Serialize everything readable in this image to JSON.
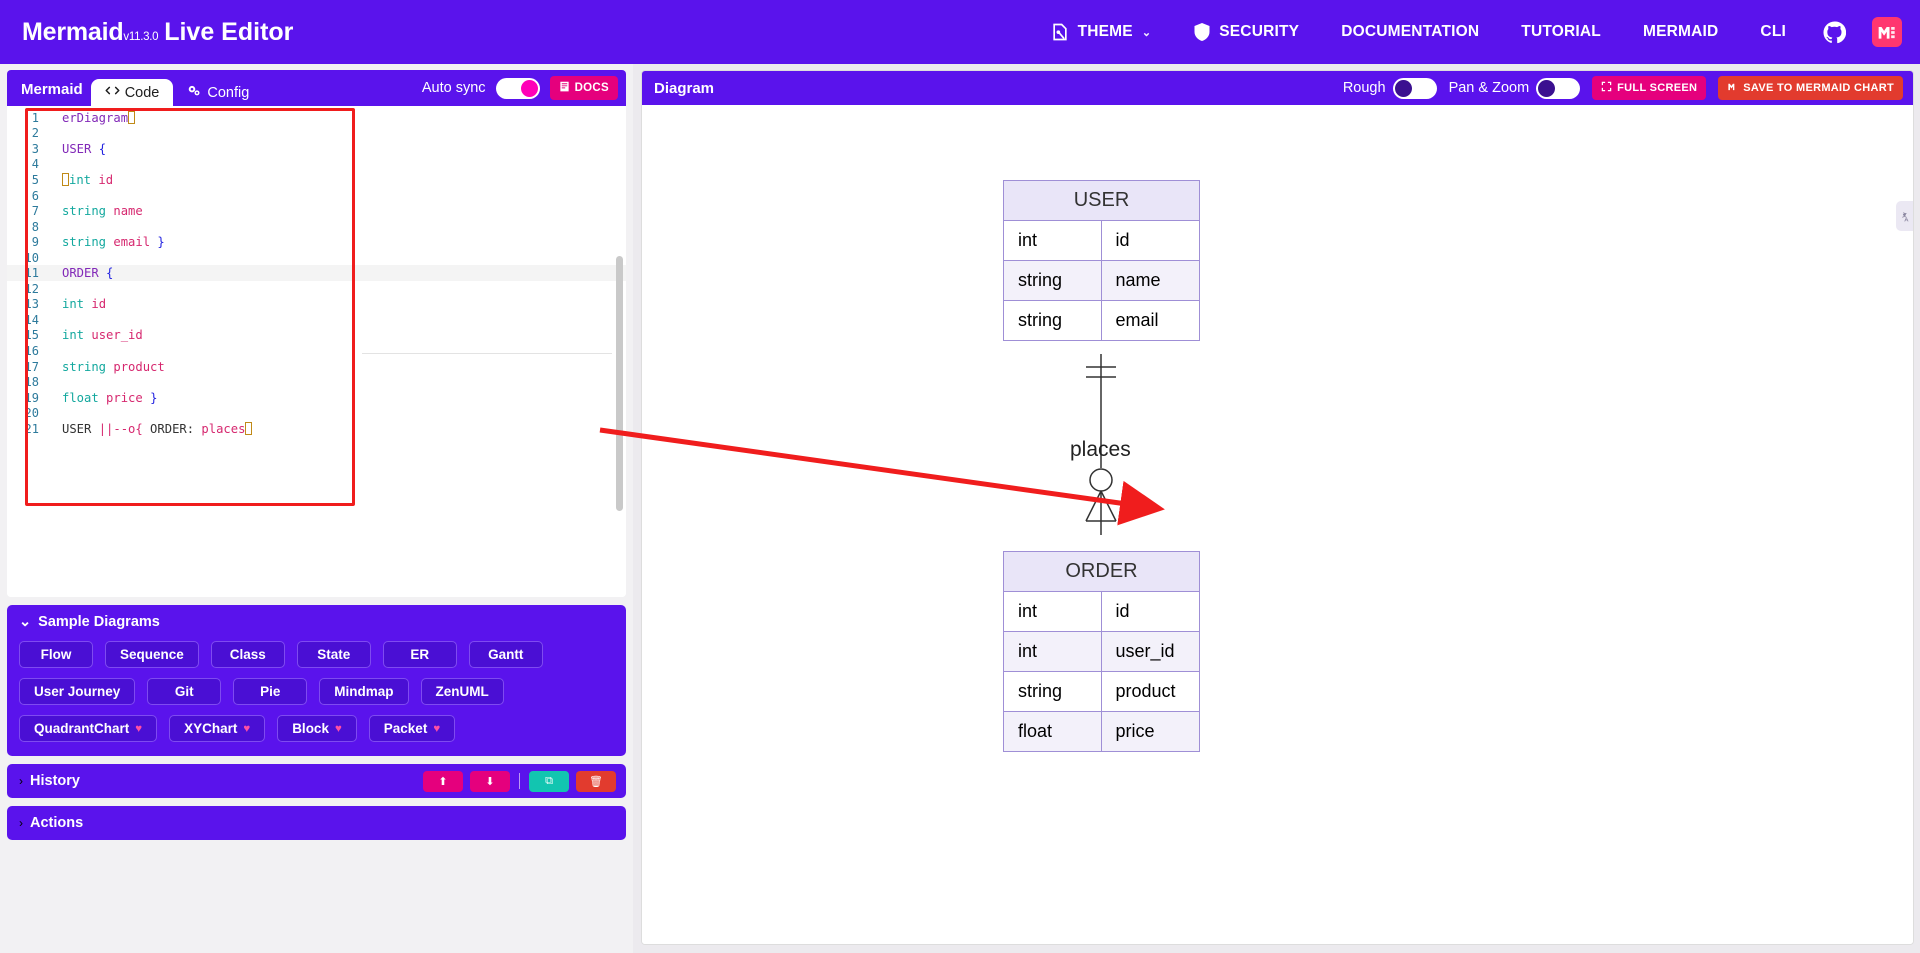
{
  "header": {
    "brand_main": "Mermaid",
    "brand_version": "v11.3.0",
    "brand_tail": "Live Editor",
    "nav": [
      {
        "label": "THEME",
        "icon": "theme-icon",
        "caret": "⌄"
      },
      {
        "label": "SECURITY",
        "icon": "shield-icon"
      },
      {
        "label": "DOCUMENTATION",
        "icon": ""
      },
      {
        "label": "TUTORIAL",
        "icon": ""
      },
      {
        "label": "MERMAID",
        "icon": ""
      },
      {
        "label": "CLI",
        "icon": ""
      }
    ],
    "github_icon": "github-icon",
    "mermaidchart_logo": "mermaid-chart-logo"
  },
  "editor": {
    "panel_label": "Mermaid",
    "tabs": [
      {
        "label": "Code",
        "icon": "code-icon",
        "active": true
      },
      {
        "label": "Config",
        "icon": "gear-icon",
        "active": false
      }
    ],
    "auto_sync_label": "Auto sync",
    "auto_sync_on": true,
    "docs_label": "DOCS",
    "docs_icon": "book-icon",
    "code_lines": [
      {
        "n": 1,
        "tokens": [
          {
            "t": "erDiagram",
            "c": "k-kw"
          },
          {
            "t": "▯",
            "c": "caret"
          }
        ]
      },
      {
        "n": 2,
        "tokens": []
      },
      {
        "n": 3,
        "tokens": [
          {
            "t": "USER ",
            "c": "k-kw"
          },
          {
            "t": "{",
            "c": "k-brace"
          }
        ]
      },
      {
        "n": 4,
        "tokens": []
      },
      {
        "n": 5,
        "tokens": [
          {
            "t": "▯",
            "c": "caret"
          },
          {
            "t": "int ",
            "c": "k-type"
          },
          {
            "t": "id",
            "c": "k-attr"
          }
        ]
      },
      {
        "n": 6,
        "tokens": []
      },
      {
        "n": 7,
        "tokens": [
          {
            "t": "string ",
            "c": "k-type"
          },
          {
            "t": "name",
            "c": "k-attr"
          }
        ]
      },
      {
        "n": 8,
        "tokens": []
      },
      {
        "n": 9,
        "tokens": [
          {
            "t": "string ",
            "c": "k-type"
          },
          {
            "t": "email ",
            "c": "k-attr"
          },
          {
            "t": "}",
            "c": "k-brace"
          }
        ]
      },
      {
        "n": 10,
        "tokens": []
      },
      {
        "n": 11,
        "tokens": [
          {
            "t": "ORDER ",
            "c": "k-kw"
          },
          {
            "t": "{",
            "c": "k-brace"
          }
        ],
        "highlight": true
      },
      {
        "n": 12,
        "tokens": []
      },
      {
        "n": 13,
        "tokens": [
          {
            "t": "int ",
            "c": "k-type"
          },
          {
            "t": "id",
            "c": "k-attr"
          }
        ]
      },
      {
        "n": 14,
        "tokens": []
      },
      {
        "n": 15,
        "tokens": [
          {
            "t": "int ",
            "c": "k-type"
          },
          {
            "t": "user_id",
            "c": "k-attr"
          }
        ]
      },
      {
        "n": 16,
        "tokens": []
      },
      {
        "n": 17,
        "tokens": [
          {
            "t": "string ",
            "c": "k-type"
          },
          {
            "t": "product",
            "c": "k-attr"
          }
        ]
      },
      {
        "n": 18,
        "tokens": []
      },
      {
        "n": 19,
        "tokens": [
          {
            "t": "float ",
            "c": "k-type"
          },
          {
            "t": "price ",
            "c": "k-attr"
          },
          {
            "t": "}",
            "c": "k-brace"
          }
        ]
      },
      {
        "n": 20,
        "tokens": []
      },
      {
        "n": 21,
        "tokens": [
          {
            "t": "USER ",
            "c": "k-plain"
          },
          {
            "t": "||--o{",
            "c": "k-rel"
          },
          {
            "t": " ORDER: ",
            "c": "k-plain"
          },
          {
            "t": "places",
            "c": "k-attr"
          },
          {
            "t": "▯",
            "c": "caret"
          }
        ]
      }
    ]
  },
  "samples": {
    "title": "Sample Diagrams",
    "chevron": "⌄",
    "buttons": [
      {
        "label": "Flow",
        "premium": false
      },
      {
        "label": "Sequence",
        "premium": false
      },
      {
        "label": "Class",
        "premium": false
      },
      {
        "label": "State",
        "premium": false
      },
      {
        "label": "ER",
        "premium": false
      },
      {
        "label": "Gantt",
        "premium": false
      },
      {
        "label": "User Journey",
        "premium": false
      },
      {
        "label": "Git",
        "premium": false
      },
      {
        "label": "Pie",
        "premium": false
      },
      {
        "label": "Mindmap",
        "premium": false
      },
      {
        "label": "ZenUML",
        "premium": false
      },
      {
        "label": "QuadrantChart",
        "premium": true
      },
      {
        "label": "XYChart",
        "premium": true
      },
      {
        "label": "Block",
        "premium": true
      },
      {
        "label": "Packet",
        "premium": true
      }
    ]
  },
  "history": {
    "title": "History",
    "chevron": "›",
    "buttons": [
      {
        "name": "upload-button",
        "icon": "⬆",
        "color": "pink"
      },
      {
        "name": "download-button",
        "icon": "⬇",
        "color": "pink"
      },
      {
        "name": "save-image-button",
        "icon": "⧉",
        "color": "teal"
      },
      {
        "name": "delete-button",
        "icon": "🗑",
        "color": "red"
      }
    ]
  },
  "actions": {
    "title": "Actions",
    "chevron": "›"
  },
  "diagram_panel": {
    "title": "Diagram",
    "rough_label": "Rough",
    "rough_on": false,
    "panzoom_label": "Pan & Zoom",
    "panzoom_on": false,
    "fullscreen_label": "FULL SCREEN",
    "fullscreen_icon": "expand-icon",
    "save_label": "SAVE TO MERMAID CHART",
    "save_icon": "mermaid-chart-icon"
  },
  "er_diagram": {
    "relationship_label": "places",
    "entities": [
      {
        "name": "USER",
        "attributes": [
          {
            "type": "int",
            "field": "id"
          },
          {
            "type": "string",
            "field": "name"
          },
          {
            "type": "string",
            "field": "email"
          }
        ]
      },
      {
        "name": "ORDER",
        "attributes": [
          {
            "type": "int",
            "field": "id"
          },
          {
            "type": "int",
            "field": "user_id"
          },
          {
            "type": "string",
            "field": "product"
          },
          {
            "type": "float",
            "field": "price"
          }
        ]
      }
    ]
  },
  "colors": {
    "brand_purple": "#5a13ec",
    "accent_pink": "#e5007d",
    "annotation_red": "#f01d1d",
    "entity_fill": "#e9e5f8",
    "entity_border": "#9f8fd6"
  }
}
